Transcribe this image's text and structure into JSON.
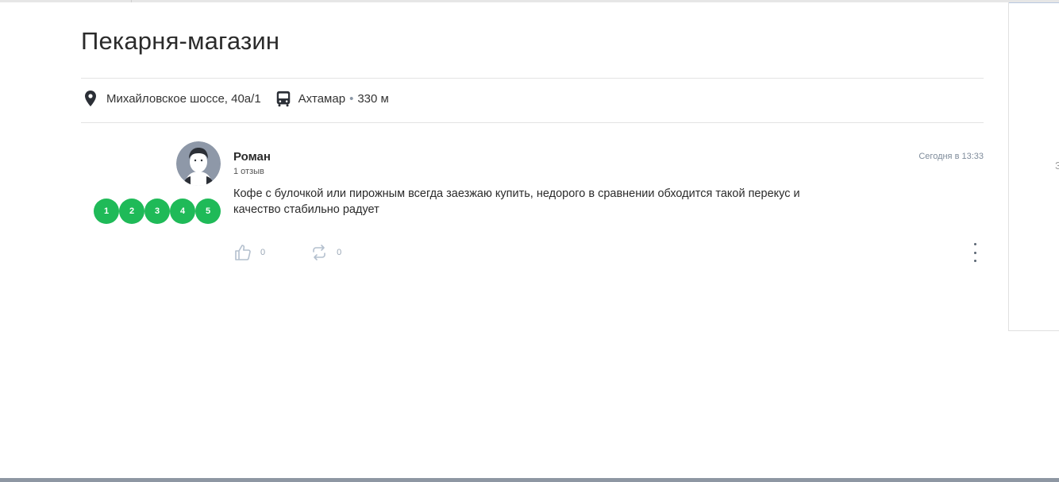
{
  "place": {
    "title": "Пекарня-магазин",
    "address": "Михайловское шоссе, 40а/1",
    "transit_stop": "Ахтамар",
    "transit_separator": "•",
    "transit_distance": "330 м"
  },
  "review": {
    "author": "Роман",
    "reviews_count": "1 отзыв",
    "date": "Сегодня в 13:33",
    "rating_scale": [
      "1",
      "2",
      "3",
      "4",
      "5"
    ],
    "rating_color": "#1fba58",
    "text": "Кофе с булочкой или пирожным всегда заезжаю купить, недорого в сравнении обходится такой перекус и качество стабильно радует",
    "likes": "0",
    "reposts": "0"
  },
  "side_panel": {
    "glyph": "З"
  },
  "icons": {
    "address": "map-pin-icon",
    "transit": "bus-icon",
    "like": "thumbs-up-icon",
    "repost": "repost-icon",
    "more": "more-vertical-icon"
  }
}
